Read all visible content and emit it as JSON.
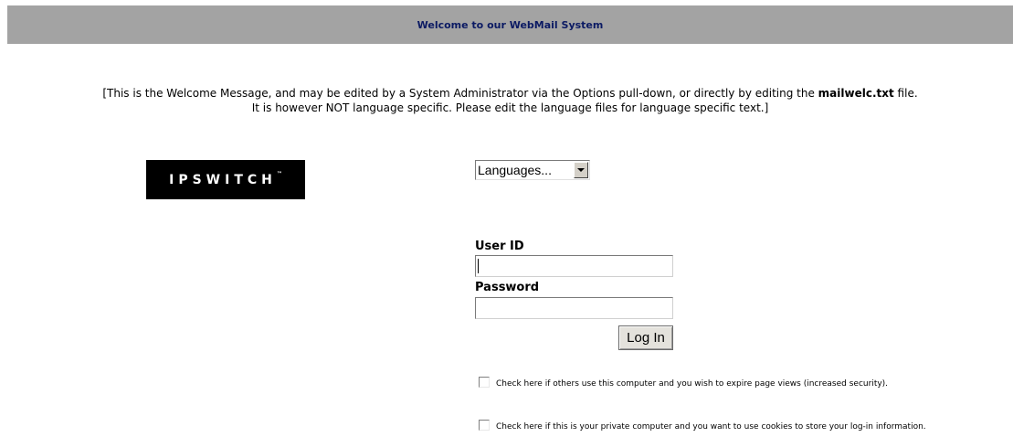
{
  "header": {
    "title": "Welcome to our WebMail System"
  },
  "welcome": {
    "line1_prefix": "[This is the Welcome Message, and may be edited by a System Administrator via the Options pull-down, or directly by editing the ",
    "filename": "mailwelc.txt",
    "line1_suffix": " file.",
    "line2": "It is however NOT language specific. Please edit the language files for language specific text.]"
  },
  "logo": {
    "text": "IPSWITCH",
    "trademark": "™"
  },
  "language_select": {
    "selected": "Languages..."
  },
  "login": {
    "user_id_label": "User ID",
    "user_id_value": "",
    "password_label": "Password",
    "password_value": "",
    "button_label": "Log In"
  },
  "options": {
    "expire_views": {
      "label": "Check here if others use this computer and you wish to expire page views (increased security).",
      "checked": false
    },
    "use_cookies": {
      "label": "Check here if this is your private computer and you want to use cookies to store your log-in information.",
      "checked": false
    }
  },
  "colors": {
    "header_bg": "#a3a3a3",
    "header_text": "#0b1a63",
    "logo_bg": "#000000"
  }
}
